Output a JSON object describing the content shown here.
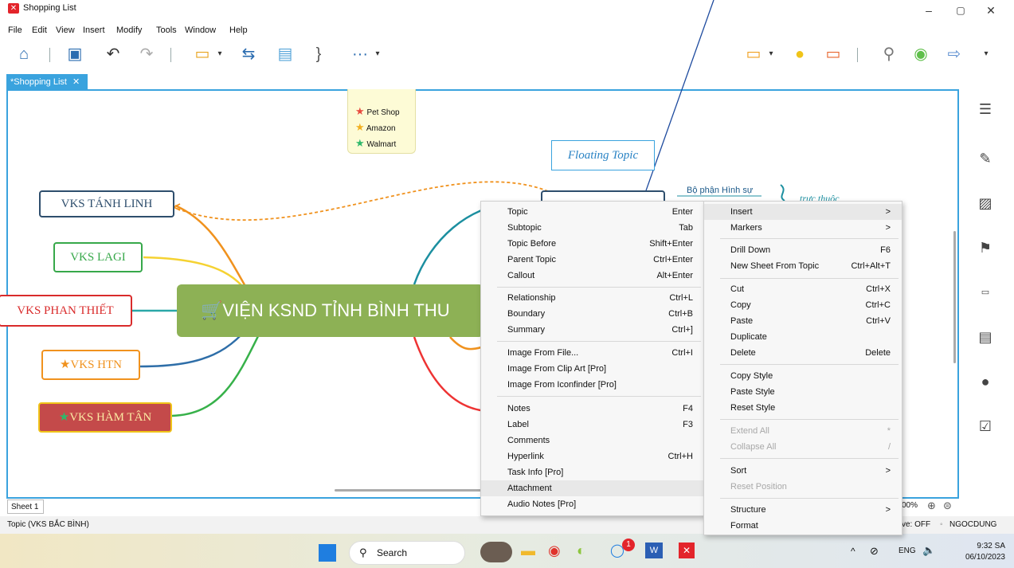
{
  "window": {
    "title": "Shopping List",
    "minimize": "–",
    "maximize": "▢",
    "close": "✕"
  },
  "menu": [
    "File",
    "Edit",
    "View",
    "Insert",
    "Modify",
    "Tools",
    "Window",
    "Help"
  ],
  "tab": {
    "label": "*Shopping List",
    "close": "✕"
  },
  "legend": {
    "items": [
      {
        "label": "Pet Shop",
        "color": "#e84a3f"
      },
      {
        "label": "Amazon",
        "color": "#f2b020"
      },
      {
        "label": "Walmart",
        "color": "#2fb86a"
      }
    ]
  },
  "mindmap": {
    "central": "VIỆN KSND TỈNH BÌNH THU",
    "nodes": [
      {
        "label": "VKS TÁNH LINH",
        "color": "#2e4e6d"
      },
      {
        "label": "VKS LAGI",
        "color": "#37a84a"
      },
      {
        "label": "VKS PHAN THIẾT",
        "color": "#d92b2b"
      },
      {
        "label": "VKS HTN",
        "color": "#f0921e"
      },
      {
        "label": "VKS HÀM TÂN",
        "color": "#c44a4a"
      }
    ],
    "floating": "Floating Topic",
    "subtopic": "Bộ phận Hình sự",
    "relation_label": "trực thuộc"
  },
  "context_menu_left": [
    {
      "label": "Topic",
      "shortcut": "Enter"
    },
    {
      "label": "Subtopic",
      "shortcut": "Tab"
    },
    {
      "label": "Topic Before",
      "shortcut": "Shift+Enter"
    },
    {
      "label": "Parent Topic",
      "shortcut": "Ctrl+Enter"
    },
    {
      "label": "Callout",
      "shortcut": "Alt+Enter"
    },
    {
      "label": "Relationship",
      "shortcut": "Ctrl+L"
    },
    {
      "label": "Boundary",
      "shortcut": "Ctrl+B"
    },
    {
      "label": "Summary",
      "shortcut": "Ctrl+]"
    },
    {
      "label": "Image From File...",
      "shortcut": "Ctrl+I"
    },
    {
      "label": "Image From Clip Art [Pro]",
      "shortcut": ""
    },
    {
      "label": "Image From Iconfinder [Pro]",
      "shortcut": ""
    },
    {
      "label": "Notes",
      "shortcut": "F4"
    },
    {
      "label": "Label",
      "shortcut": "F3"
    },
    {
      "label": "Comments",
      "shortcut": ""
    },
    {
      "label": "Hyperlink",
      "shortcut": "Ctrl+H"
    },
    {
      "label": "Task Info [Pro]",
      "shortcut": ""
    },
    {
      "label": "Attachment",
      "shortcut": ""
    },
    {
      "label": "Audio Notes [Pro]",
      "shortcut": ""
    }
  ],
  "context_menu_right": [
    {
      "label": "Insert",
      "shortcut": ">"
    },
    {
      "label": "Markers",
      "shortcut": ">"
    },
    {
      "label": "Drill Down",
      "shortcut": "F6"
    },
    {
      "label": "New Sheet From Topic",
      "shortcut": "Ctrl+Alt+T"
    },
    {
      "label": "Cut",
      "shortcut": "Ctrl+X"
    },
    {
      "label": "Copy",
      "shortcut": "Ctrl+C"
    },
    {
      "label": "Paste",
      "shortcut": "Ctrl+V"
    },
    {
      "label": "Duplicate",
      "shortcut": ""
    },
    {
      "label": "Delete",
      "shortcut": "Delete"
    },
    {
      "label": "Copy Style",
      "shortcut": ""
    },
    {
      "label": "Paste Style",
      "shortcut": ""
    },
    {
      "label": "Reset Style",
      "shortcut": ""
    },
    {
      "label": "Extend All",
      "shortcut": "*"
    },
    {
      "label": "Collapse All",
      "shortcut": "/"
    },
    {
      "label": "Sort",
      "shortcut": ">"
    },
    {
      "label": "Reset Position",
      "shortcut": ""
    },
    {
      "label": "Structure",
      "shortcut": ">"
    },
    {
      "label": "Format",
      "shortcut": ""
    }
  ],
  "sheet": {
    "label": "Sheet 1",
    "zoom": "00%"
  },
  "status": {
    "left": "Topic (VKS BẮC BÌNH)",
    "right_save": "ve: OFF",
    "user": "NGOCDUNG"
  },
  "taskbar": {
    "search": "Search",
    "lang": "ENG",
    "time": "9:32 SA",
    "date": "06/10/2023",
    "badge": "1"
  }
}
